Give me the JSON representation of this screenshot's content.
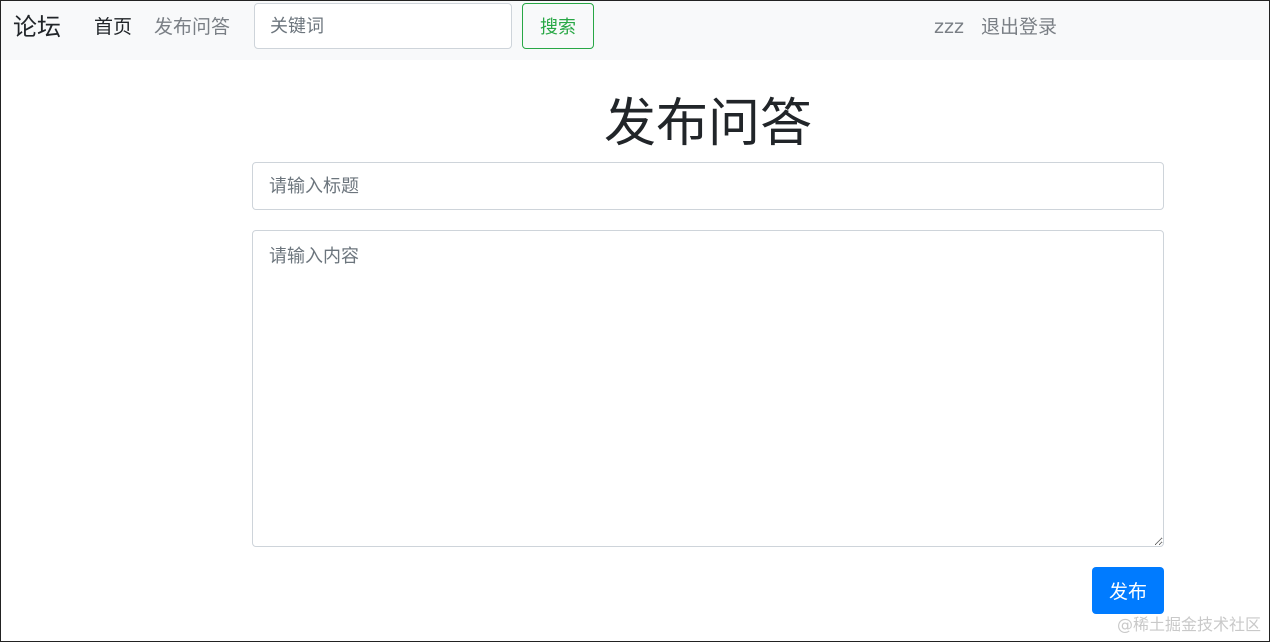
{
  "navbar": {
    "brand": "论坛",
    "links": {
      "home": "首页",
      "publish": "发布问答",
      "user": "zzz",
      "logout": "退出登录"
    },
    "search": {
      "placeholder": "关键词",
      "value": "",
      "button_label": "搜索"
    }
  },
  "main": {
    "title": "发布问答",
    "title_input": {
      "placeholder": "请输入标题",
      "value": ""
    },
    "content_input": {
      "placeholder": "请输入内容",
      "value": ""
    },
    "submit_label": "发布"
  },
  "watermark": "@稀土掘金技术社区",
  "colors": {
    "navbar_bg": "#f8f9fa",
    "success": "#28a745",
    "primary": "#007bff",
    "muted_text": "#7a7f85"
  }
}
